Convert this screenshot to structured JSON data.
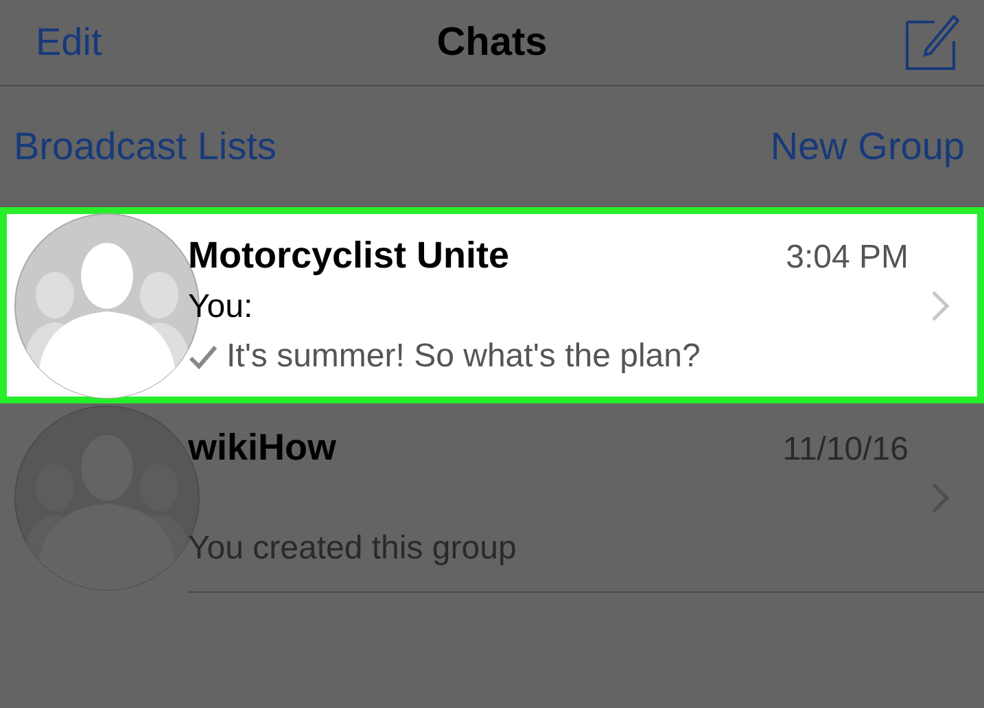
{
  "nav": {
    "edit": "Edit",
    "title": "Chats"
  },
  "links": {
    "left": "Broadcast Lists",
    "right": "New Group"
  },
  "chats": [
    {
      "name": "Motorcyclist Unite",
      "time": "3:04 PM",
      "sender": "You:",
      "preview": "It's summer! So what's the plan?",
      "sent": true,
      "selected": true
    },
    {
      "name": "wikiHow",
      "time": "11/10/16",
      "preview": "You created this group",
      "sent": false,
      "selected": false
    }
  ]
}
